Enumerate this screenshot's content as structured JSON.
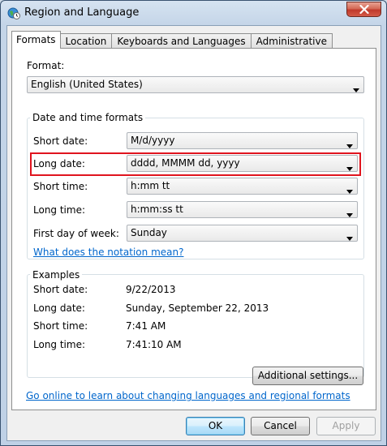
{
  "window": {
    "title": "Region and Language"
  },
  "tabs": [
    {
      "label": "Formats"
    },
    {
      "label": "Location"
    },
    {
      "label": "Keyboards and Languages"
    },
    {
      "label": "Administrative"
    }
  ],
  "format": {
    "label": "Format:",
    "value": "English (United States)"
  },
  "datetime": {
    "group_title": "Date and time formats",
    "short_date": {
      "label": "Short date:",
      "value": "M/d/yyyy"
    },
    "long_date": {
      "label": "Long date:",
      "value": "dddd, MMMM dd, yyyy"
    },
    "short_time": {
      "label": "Short time:",
      "value": "h:mm tt"
    },
    "long_time": {
      "label": "Long time:",
      "value": "h:mm:ss tt"
    },
    "first_day": {
      "label": "First day of week:",
      "value": "Sunday"
    },
    "notation_link": "What does the notation mean?"
  },
  "examples": {
    "group_title": "Examples",
    "short_date": {
      "label": "Short date:",
      "value": "9/22/2013"
    },
    "long_date": {
      "label": "Long date:",
      "value": "Sunday, September 22, 2013"
    },
    "short_time": {
      "label": "Short time:",
      "value": "7:41 AM"
    },
    "long_time": {
      "label": "Long time:",
      "value": "7:41:10 AM"
    }
  },
  "additional_settings": "Additional settings...",
  "online_link": "Go online to learn about changing languages and regional formats",
  "buttons": {
    "ok": "OK",
    "cancel": "Cancel",
    "apply": "Apply"
  },
  "colors": {
    "highlight": "#e0141e",
    "link": "#0066cc"
  }
}
